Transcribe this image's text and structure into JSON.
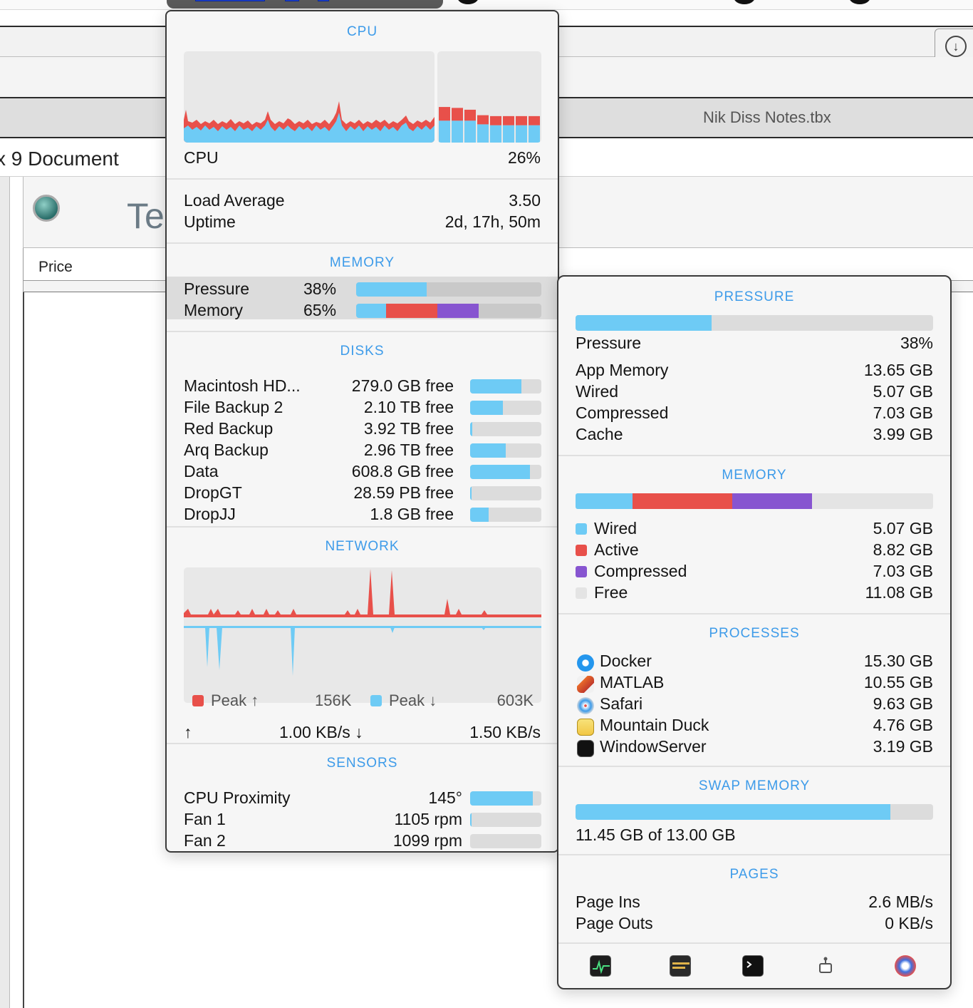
{
  "background": {
    "window_title": "Nik Diss Notes.tbx",
    "document_label": "x 9 Document",
    "header_fragment": "Te",
    "column_price": "Price"
  },
  "cpu": {
    "header": "CPU",
    "label": "CPU",
    "value": "26%",
    "load_label": "Load Average",
    "load_value": "3.50",
    "uptime_label": "Uptime",
    "uptime_value": "2d, 17h, 50m",
    "history_bars": [
      {
        "user": 0.24,
        "system": 0.15
      },
      {
        "user": 0.24,
        "system": 0.14
      },
      {
        "user": 0.24,
        "system": 0.12
      },
      {
        "user": 0.2,
        "system": 0.1
      },
      {
        "user": 0.19,
        "system": 0.1
      },
      {
        "user": 0.19,
        "system": 0.1
      },
      {
        "user": 0.19,
        "system": 0.1
      },
      {
        "user": 0.19,
        "system": 0.1
      }
    ]
  },
  "memory": {
    "header": "MEMORY",
    "pressure_label": "Pressure",
    "pressure_value": "38%",
    "pressure_fraction": 0.38,
    "memory_label": "Memory",
    "memory_value": "65%"
  },
  "disks": {
    "header": "DISKS",
    "items": [
      {
        "name": "Macintosh HD...",
        "free": "279.0 GB free",
        "fill": 0.72
      },
      {
        "name": "File Backup 2",
        "free": "2.10 TB free",
        "fill": 0.46
      },
      {
        "name": "Red  Backup",
        "free": "3.92 TB free",
        "fill": 0.03
      },
      {
        "name": "Arq Backup",
        "free": "2.96 TB free",
        "fill": 0.5
      },
      {
        "name": "Data",
        "free": "608.8 GB free",
        "fill": 0.84
      },
      {
        "name": "DropGT",
        "free": "28.59 PB free",
        "fill": 0.02
      },
      {
        "name": "DropJJ",
        "free": "1.8 GB free",
        "fill": 0.26
      }
    ]
  },
  "network": {
    "header": "NETWORK",
    "peak_up_label": "Peak",
    "peak_up_value": "156K",
    "peak_down_label": "Peak",
    "peak_down_value": "603K",
    "up_rate": "1.00 KB/s",
    "down_rate": "1.50 KB/s"
  },
  "sensors": {
    "header": "SENSORS",
    "items": [
      {
        "name": "CPU Proximity",
        "value": "145°",
        "fill": 0.88
      },
      {
        "name": "Fan 1",
        "value": "1105 rpm",
        "fill": 0.02
      },
      {
        "name": "Fan 2",
        "value": "1099 rpm",
        "fill": 0.0
      }
    ]
  },
  "detail": {
    "pressure_header": "PRESSURE",
    "pressure_fraction": 0.38,
    "pressure_rows": [
      {
        "label": "Pressure",
        "value": "38%"
      },
      {
        "label": "App Memory",
        "value": "13.65 GB"
      },
      {
        "label": "Wired",
        "value": "5.07 GB"
      },
      {
        "label": "Compressed",
        "value": "7.03 GB"
      },
      {
        "label": "Cache",
        "value": "3.99 GB"
      }
    ],
    "memory_header": "MEMORY",
    "memory_rows": [
      {
        "label": "Wired",
        "value": "5.07 GB",
        "color": "#6ecbf5"
      },
      {
        "label": "Active",
        "value": "8.82 GB",
        "color": "#e8504a"
      },
      {
        "label": "Compressed",
        "value": "7.03 GB",
        "color": "#8755d0"
      },
      {
        "label": "Free",
        "value": "11.08 GB",
        "color": "#e4e4e4"
      }
    ],
    "processes_header": "PROCESSES",
    "processes": [
      {
        "name": "Docker",
        "value": "15.30 GB",
        "icon": "docker-icon"
      },
      {
        "name": "MATLAB",
        "value": "10.55 GB",
        "icon": "matlab-icon"
      },
      {
        "name": "Safari",
        "value": "9.63 GB",
        "icon": "safari-icon"
      },
      {
        "name": "Mountain Duck",
        "value": "4.76 GB",
        "icon": "mountain-duck-icon"
      },
      {
        "name": "WindowServer",
        "value": "3.19 GB",
        "icon": "window-server-icon"
      }
    ],
    "swap_header": "SWAP MEMORY",
    "swap_text": "11.45 GB of 13.00 GB",
    "swap_fraction": 0.88,
    "pages_header": "PAGES",
    "page_ins_label": "Page Ins",
    "page_ins_value": "2.6 MB/s",
    "page_outs_label": "Page Outs",
    "page_outs_value": "0 KB/s",
    "toolbar_icons": [
      "activity-monitor-icon",
      "console-icon",
      "terminal-icon",
      "system-info-icon",
      "istat-menus-icon"
    ]
  },
  "colors": {
    "accent": "#3d9be9",
    "blue": "#6ecbf5",
    "red": "#e8504a",
    "purple": "#8755d0"
  }
}
